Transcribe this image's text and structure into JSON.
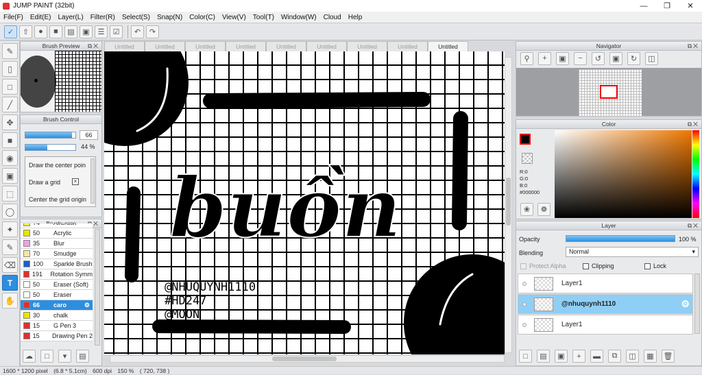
{
  "window": {
    "title": "JUMP PAINT (32bit)",
    "controls": [
      "—",
      "❐",
      "✕"
    ]
  },
  "menu": [
    "File(F)",
    "Edit(E)",
    "Layer(L)",
    "Filter(R)",
    "Select(S)",
    "Snap(N)",
    "Color(C)",
    "View(V)",
    "Tool(T)",
    "Window(W)",
    "Cloud",
    "Help"
  ],
  "panels": {
    "brush_preview": {
      "title": "Brush Preview"
    },
    "brush_control": {
      "title": "Brush Control",
      "size_value": "66",
      "opacity_value": "44 %",
      "size_level": 0.93,
      "opacity_level": 0.44,
      "options": [
        "Draw the center poin",
        "Draw a grid",
        "Center the grid origin"
      ]
    },
    "brush_list": {
      "title": "Brush: caro",
      "items": [
        {
          "num": "74",
          "name": "Airbrush",
          "color": "#ffe94d"
        },
        {
          "num": "50",
          "name": "Acrylic",
          "color": "#e6e600"
        },
        {
          "num": "35",
          "name": "Blur",
          "color": "#f0a0e0"
        },
        {
          "num": "70",
          "name": "Smudge",
          "color": "#f5e6a0"
        },
        {
          "num": "100",
          "name": "Sparkle Brush",
          "color": "#1a5fd0"
        },
        {
          "num": "191",
          "name": "Rotation Symm",
          "color": "#e03030"
        },
        {
          "num": "50",
          "name": "Eraser (Soft)",
          "color": "#ffffff"
        },
        {
          "num": "50",
          "name": "Eraser",
          "color": "#ffffff"
        },
        {
          "num": "66",
          "name": "caro",
          "color": "#e03030"
        },
        {
          "num": "30",
          "name": "chalk",
          "color": "#e6e600"
        },
        {
          "num": "15",
          "name": "G Pen 3",
          "color": "#e03030"
        },
        {
          "num": "15",
          "name": "Drawing Pen 2",
          "color": "#e03030"
        }
      ],
      "selected_index": 8
    },
    "tabs": [
      "Untitled",
      "Untitled",
      "Untitled",
      "Untitled",
      "Untitled",
      "Untitled",
      "Untitled",
      "Untitled",
      "Untitled"
    ],
    "navigator": {
      "title": "Navigator"
    },
    "color": {
      "title": "Color",
      "r_label": "R:0",
      "g_label": "G:0",
      "b_label": "B:0",
      "hex": "#000000",
      "foreground": "#000000",
      "accent_hue": "#f07800"
    },
    "layer": {
      "title": "Layer",
      "opacity_label": "Opacity",
      "opacity_value": "100 %",
      "opacity_level": 1.0,
      "blending_label": "Blending",
      "blending_value": "Normal",
      "protect_alpha": "Protect Alpha",
      "clipping": "Clipping",
      "lock": "Lock",
      "layers": [
        {
          "name": "Layer1",
          "selected": false
        },
        {
          "name": "@nhuquynh1110",
          "selected": true
        },
        {
          "name": "Layer1",
          "selected": false
        }
      ]
    }
  },
  "canvas": {
    "word": "buồn",
    "signature": [
      "@NHUQUYNH1110",
      "#HD247",
      "@MOON"
    ]
  },
  "status": {
    "size": "1600 * 1200 pixel",
    "physical": "(6.8 * 5.1cm)",
    "dpi": "600 dpi",
    "zoom": "150 %",
    "coords": "( 720, 738 )"
  }
}
